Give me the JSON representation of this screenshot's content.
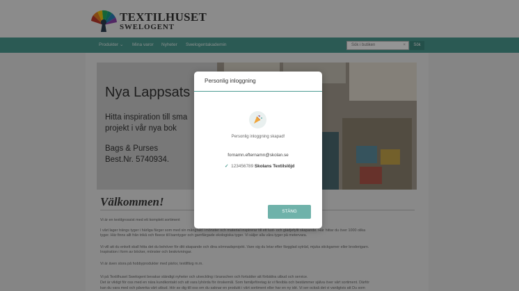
{
  "header": {
    "brand_line1": "TEXTILHUSET",
    "brand_line2": "SWELOGENT"
  },
  "nav": {
    "items": [
      {
        "label": "Produkter ⌄"
      },
      {
        "label": "Mina varor"
      },
      {
        "label": "Nyheter"
      },
      {
        "label": "Swelogentakademin"
      }
    ],
    "search_placeholder": "Sök i butiken",
    "search_clear": "×",
    "search_button": "Sök"
  },
  "banner": {
    "title": "Nya Lappsats",
    "line1": "Hitta inspiration till sma",
    "line2": "projekt i vår nya bok",
    "line3": "Bags & Purses",
    "line4": "Best.Nr. 5740934."
  },
  "main": {
    "welcome": "Välkommen!",
    "paragraphs": [
      "Vi är en textilgrossist med ett komplett sortiment",
      "I vårt lager trängs tyger i härliga färger som med sin mångfald i mönster och material inspirerar till ett lust- och glädjefyllt skapande. Här hittar du över 1000 olika",
      "tyger. Här finns allt från trikå och fleece till barntyger och garnfärgade ekologiska tyger. Vi säljer alla våra tyger på metervara.",
      "Vi vill att du enkelt skall hitta det du behöver för ditt skapande och dina sömnadsprojekt.  Vare sig du letar efter färgglad sytråd, mjuka stickgarner eller broderigarn.",
      "Inspiration i form av böcker, mönster och beskrivningar.",
      "Vi är även stora på hobbyprodukter med pärlor, textilfärg m.m.",
      "Vi på Textilhuset Swelogent bevakar ständigt nyheter och utveckling i branschen och fortsätter att förbättra utbud och service.",
      "Det är viktigt för oss med en nära kundkontakt och att vara lyhörda för önskemål. Som familjeföretag är vi flexibla och bestämmer själva över vårt sortiment. Därför",
      "kan du vara med och påverka vårt utbud. Hör av dig till oss om du saknar en produkt i vårt sortiment eller har en ny idé. Vi ser också det vi vanligtvis att Du som"
    ]
  },
  "modal": {
    "title": "Personlig inloggning",
    "icon": "party-popper-icon",
    "created_text": "Personlig inloggning skapad!",
    "email": "fornamn.efternamn@skolan.se",
    "check_icon": "✓",
    "org_number": "123456789",
    "org_name": "Skolans Textilslöjd",
    "close_label": "STÄNG"
  },
  "colors": {
    "accent": "#4a9b91",
    "button": "#6fb2aa"
  }
}
